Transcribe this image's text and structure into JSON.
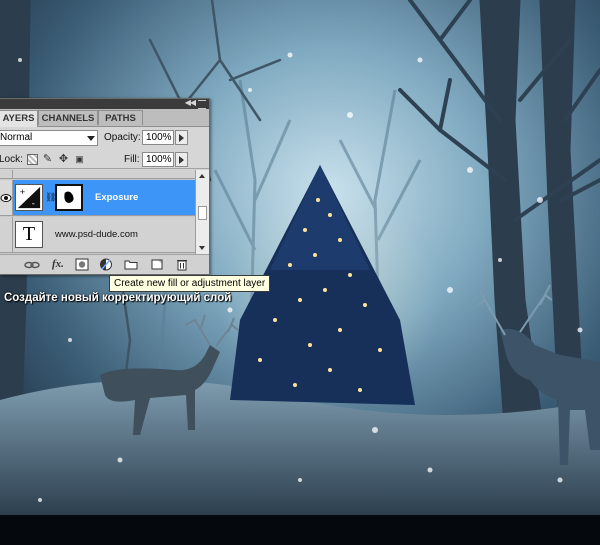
{
  "panel": {
    "tabs": [
      {
        "label": "AYERS"
      },
      {
        "label": "CHANNELS"
      },
      {
        "label": "PATHS"
      }
    ],
    "blend_mode": "Normal",
    "opacity_label": "Opacity:",
    "opacity_value": "100%",
    "lock_label": "Lock:",
    "fill_label": "Fill:",
    "fill_value": "100%",
    "layers": [
      {
        "name": "Exposure",
        "selected": true
      },
      {
        "name": "www.psd-dude.com",
        "thumb_glyph": "T"
      }
    ],
    "selection_color": "#3d96f7"
  },
  "tooltip": "Create new fill or adjustment layer",
  "caption": "Создайте новый корректирующий слой",
  "icons": [
    "collapse-icon",
    "panel-menu-icon",
    "lock-transparent-icon",
    "lock-brush-icon",
    "lock-move-icon",
    "lock-all-icon",
    "eye-icon",
    "exposure-adjustment-icon",
    "chain-link-icon",
    "layer-mask-thumbnail",
    "link-layers-icon",
    "fx-icon",
    "add-mask-icon",
    "adjustment-layer-icon",
    "group-folder-icon",
    "new-layer-icon",
    "trash-icon"
  ]
}
